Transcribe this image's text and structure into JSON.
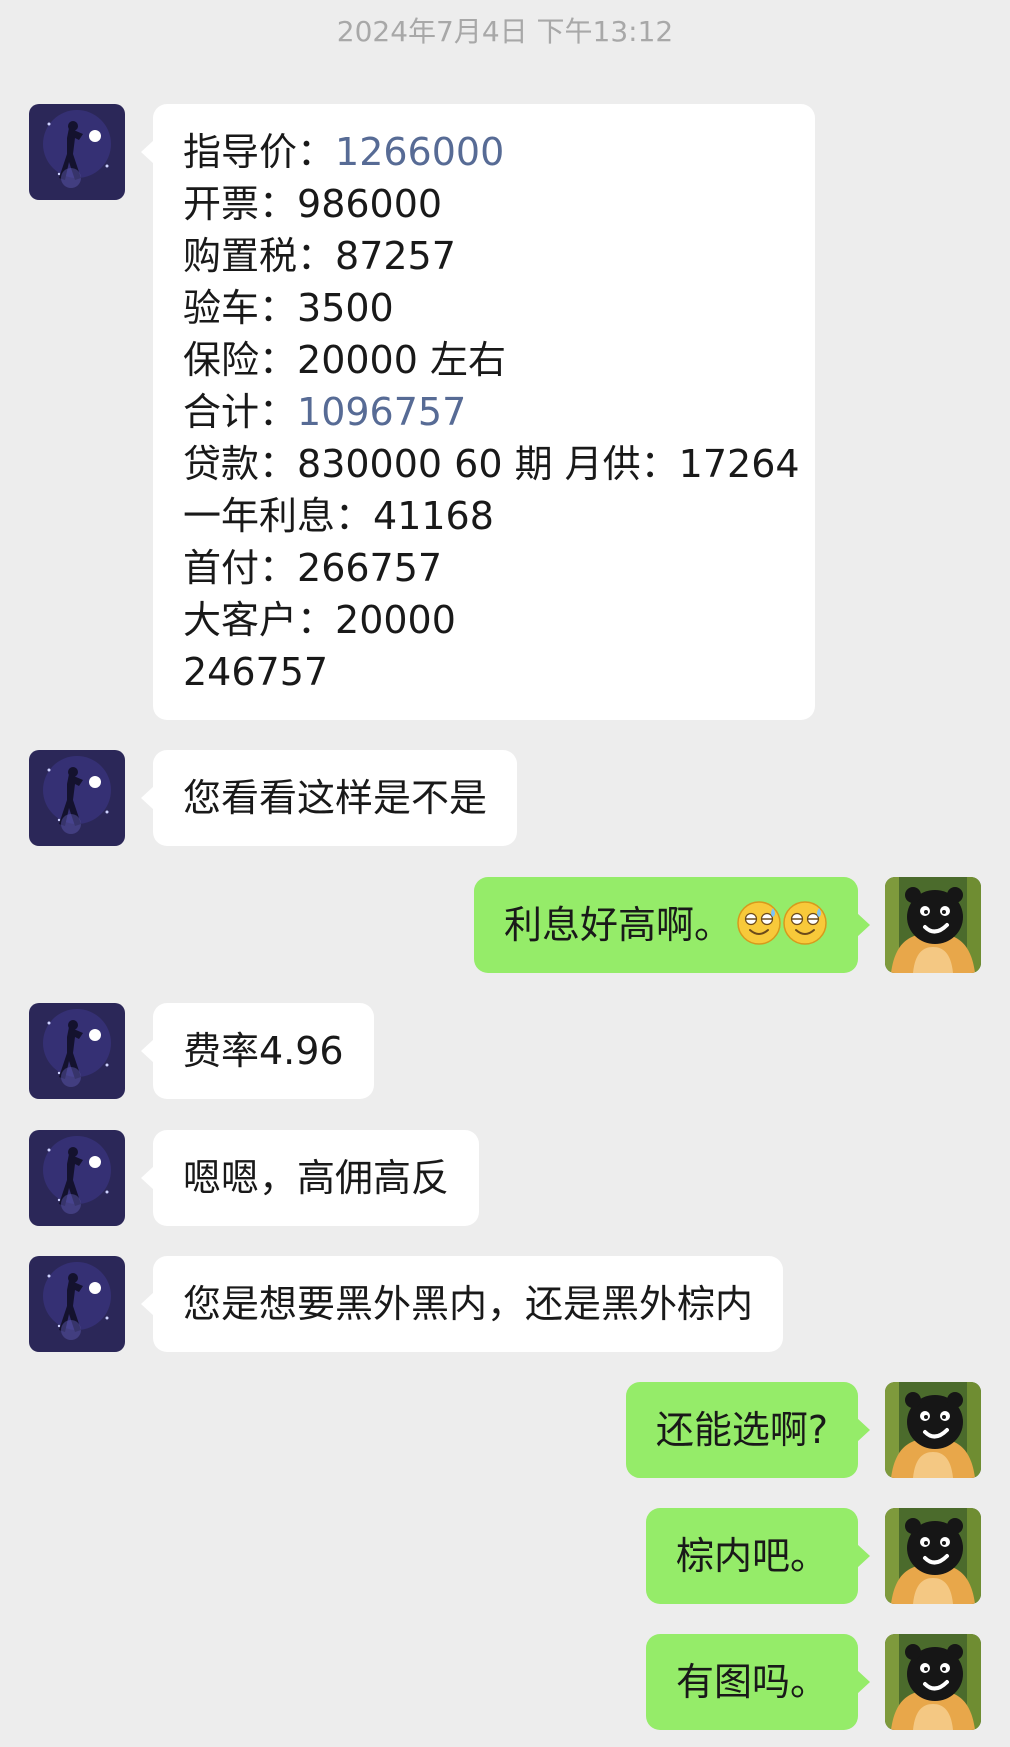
{
  "chat": {
    "timestamp": "2024年7月4日 下午13:12",
    "messages": [
      {
        "sender": "contact",
        "lines": [
          {
            "label": "指导价：",
            "value": "1266000",
            "value_style": "link"
          },
          {
            "label": "开票：",
            "value": "986000"
          },
          {
            "label": "购置税：",
            "value": "87257"
          },
          {
            "label": "验车：",
            "value": "3500"
          },
          {
            "label": "保险：",
            "value": "20000 左右"
          },
          {
            "label": "合计：",
            "value": "1096757",
            "value_style": "link"
          },
          {
            "label": "贷款：",
            "value": "830000 60 期 月供：17264"
          },
          {
            "label": "一年利息：",
            "value": "41168"
          },
          {
            "label": "首付：",
            "value": "266757"
          },
          {
            "label": "大客户：",
            "value": "20000"
          },
          {
            "label": "",
            "value": "246757"
          }
        ]
      },
      {
        "sender": "contact",
        "text": "您看看这样是不是"
      },
      {
        "sender": "me",
        "text": "利息好高啊。",
        "emoji": "grinning-sweat-emoji"
      },
      {
        "sender": "contact",
        "text": "费率4.96"
      },
      {
        "sender": "contact",
        "text": "嗯嗯，高佣高反"
      },
      {
        "sender": "contact",
        "text": "您是想要黑外黑内，还是黑外棕内"
      },
      {
        "sender": "me",
        "text": "还能选啊?"
      },
      {
        "sender": "me",
        "text": "棕内吧。"
      },
      {
        "sender": "me",
        "text": "有图吗。"
      }
    ]
  },
  "colors": {
    "background": "#ededed",
    "incoming_bubble": "#ffffff",
    "outgoing_bubble": "#95ec69",
    "link_text": "#576b95",
    "timestamp_text": "#a8a8a8"
  },
  "icons": {
    "contact_avatar": "night-sky-figure-avatar-icon",
    "my_avatar": "black-bear-avatar-icon"
  }
}
